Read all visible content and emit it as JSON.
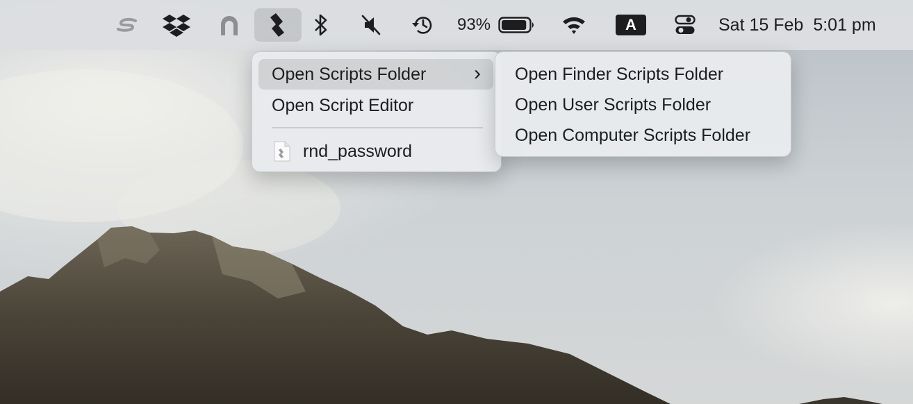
{
  "menubar": {
    "icons": [
      "setapp-icon",
      "dropbox-icon",
      "arch-app-icon",
      "script-menu-icon",
      "bluetooth-icon",
      "mute-icon",
      "time-machine-icon",
      "battery-icon",
      "wifi-icon",
      "input-source-icon",
      "control-center-icon"
    ],
    "battery_percent": "93%",
    "battery_level": 0.93,
    "input_source": "A",
    "date": "Sat 15 Feb",
    "time": "5:01 pm"
  },
  "script_menu": {
    "items": [
      {
        "label": "Open Scripts Folder",
        "has_submenu": true,
        "highlighted": true
      },
      {
        "label": "Open Script Editor"
      },
      {
        "label": "rnd_password",
        "icon": "script-file-icon"
      }
    ],
    "submenu_indicator": "›"
  },
  "submenu": {
    "items": [
      {
        "label": "Open Finder Scripts Folder"
      },
      {
        "label": "Open User Scripts Folder"
      },
      {
        "label": "Open Computer Scripts Folder"
      }
    ]
  }
}
